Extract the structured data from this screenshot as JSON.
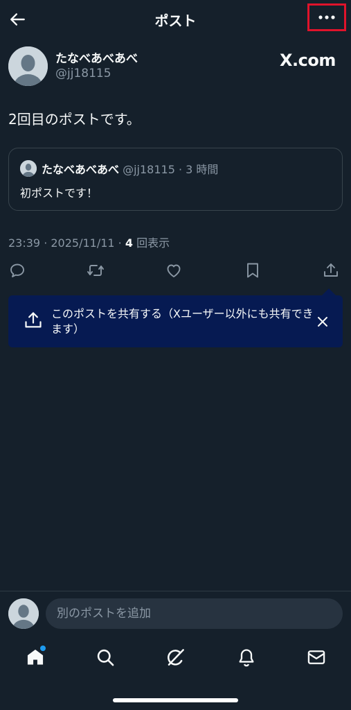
{
  "header": {
    "title": "ポスト",
    "back_icon": "arrow-left-icon",
    "more_icon": "more-horizontal-icon"
  },
  "post": {
    "author_name": "たなべあべあべ",
    "author_handle": "@jj18115",
    "source_logo": "X.com",
    "text": "2回目のポストです。",
    "quote": {
      "author_name": "たなべあべあべ",
      "meta": "@jj18115 · 3 時間",
      "text": "初ポストです！"
    },
    "meta_prefix": "23:39 · 2025/11/11 · ",
    "view_count": "4",
    "view_suffix": " 回表示"
  },
  "actions": [
    {
      "name": "reply-icon"
    },
    {
      "name": "repost-icon"
    },
    {
      "name": "like-icon"
    },
    {
      "name": "bookmark-icon"
    },
    {
      "name": "share-icon"
    }
  ],
  "share_tooltip": {
    "text": "このポストを共有する（Xユーザー以外にも共有できます）",
    "close_icon": "close-icon"
  },
  "reply": {
    "placeholder": "別のポストを追加"
  },
  "bottom_nav": [
    {
      "name": "home-icon",
      "active": true,
      "badge": true
    },
    {
      "name": "search-icon"
    },
    {
      "name": "grok-icon"
    },
    {
      "name": "notifications-icon"
    },
    {
      "name": "messages-icon"
    }
  ],
  "colors": {
    "background": "#15202b",
    "tooltip": "#061a52",
    "accent": "#1d9bf0",
    "highlight": "#e0132b",
    "muted_text": "#8b98a5"
  }
}
